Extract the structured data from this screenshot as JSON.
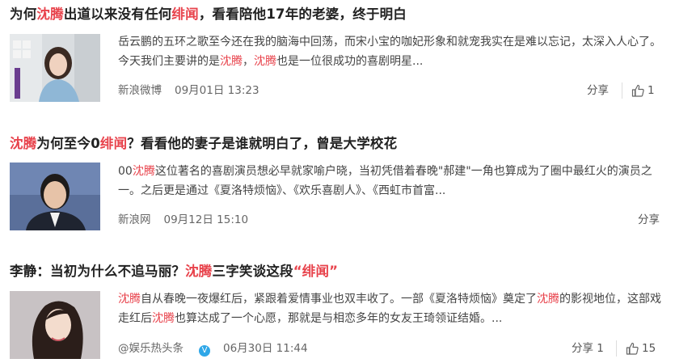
{
  "articles": [
    {
      "title_parts": [
        "为何",
        "沈腾",
        "出道以来没有任何",
        "绯闻",
        "，看看陪他17年的老婆，终于明白"
      ],
      "summary_parts": [
        "岳云鹏的五环之歌至今还在我的脑海中回荡，而宋小宝的咖妃形象和就宠我实在是难以忘记，太深入人心了。今天我们主要讲的是",
        "沈腾",
        "，",
        "沈腾",
        "也是一位很成功的喜剧明星..."
      ],
      "source": "新浪微博",
      "date": "09月01日 13:23",
      "share_label": "分享",
      "like_count": "1",
      "thumb_icon": "woman-in-kitchen-photo"
    },
    {
      "title_parts": [
        "沈腾",
        "为何至今0",
        "绯闻",
        "？看看他的妻子是谁就明白了，曾是大学校花"
      ],
      "summary_parts": [
        "00",
        "沈腾",
        "这位著名的喜剧演员想必早就家喻户晓，当初凭借着春晚\"郝建\"一角也算成为了圈中最红火的演员之一。之后更是通过《夏洛特烦恼》、《欢乐喜剧人》、《西虹市首富..."
      ],
      "source": "新浪网",
      "date": "09月12日 15:10",
      "share_label": "分享",
      "thumb_icon": "man-in-suit-photo"
    },
    {
      "title_parts": [
        "李静：当初为什么不追马丽？",
        "沈腾",
        "三字笑谈这段",
        "“绯闻”"
      ],
      "summary_parts": [
        "沈腾",
        "自从春晚一夜爆红后，紧跟着爱情事业也双丰收了。一部《夏洛特烦恼》奠定了",
        "沈腾",
        "的影视地位，这部戏走红后",
        "沈腾",
        "也算达成了一个心愿，那就是与相恋多年的女友王琦领证结婚。..."
      ],
      "source": "@娱乐热头条",
      "verified_mark": "V",
      "date": "06月30日 11:44",
      "share_label": "分享 1",
      "like_count": "15",
      "thumb_icon": "woman-portrait-photo"
    }
  ],
  "colors": {
    "highlight": "#e8434c",
    "text": "#222222",
    "meta": "#666666"
  }
}
